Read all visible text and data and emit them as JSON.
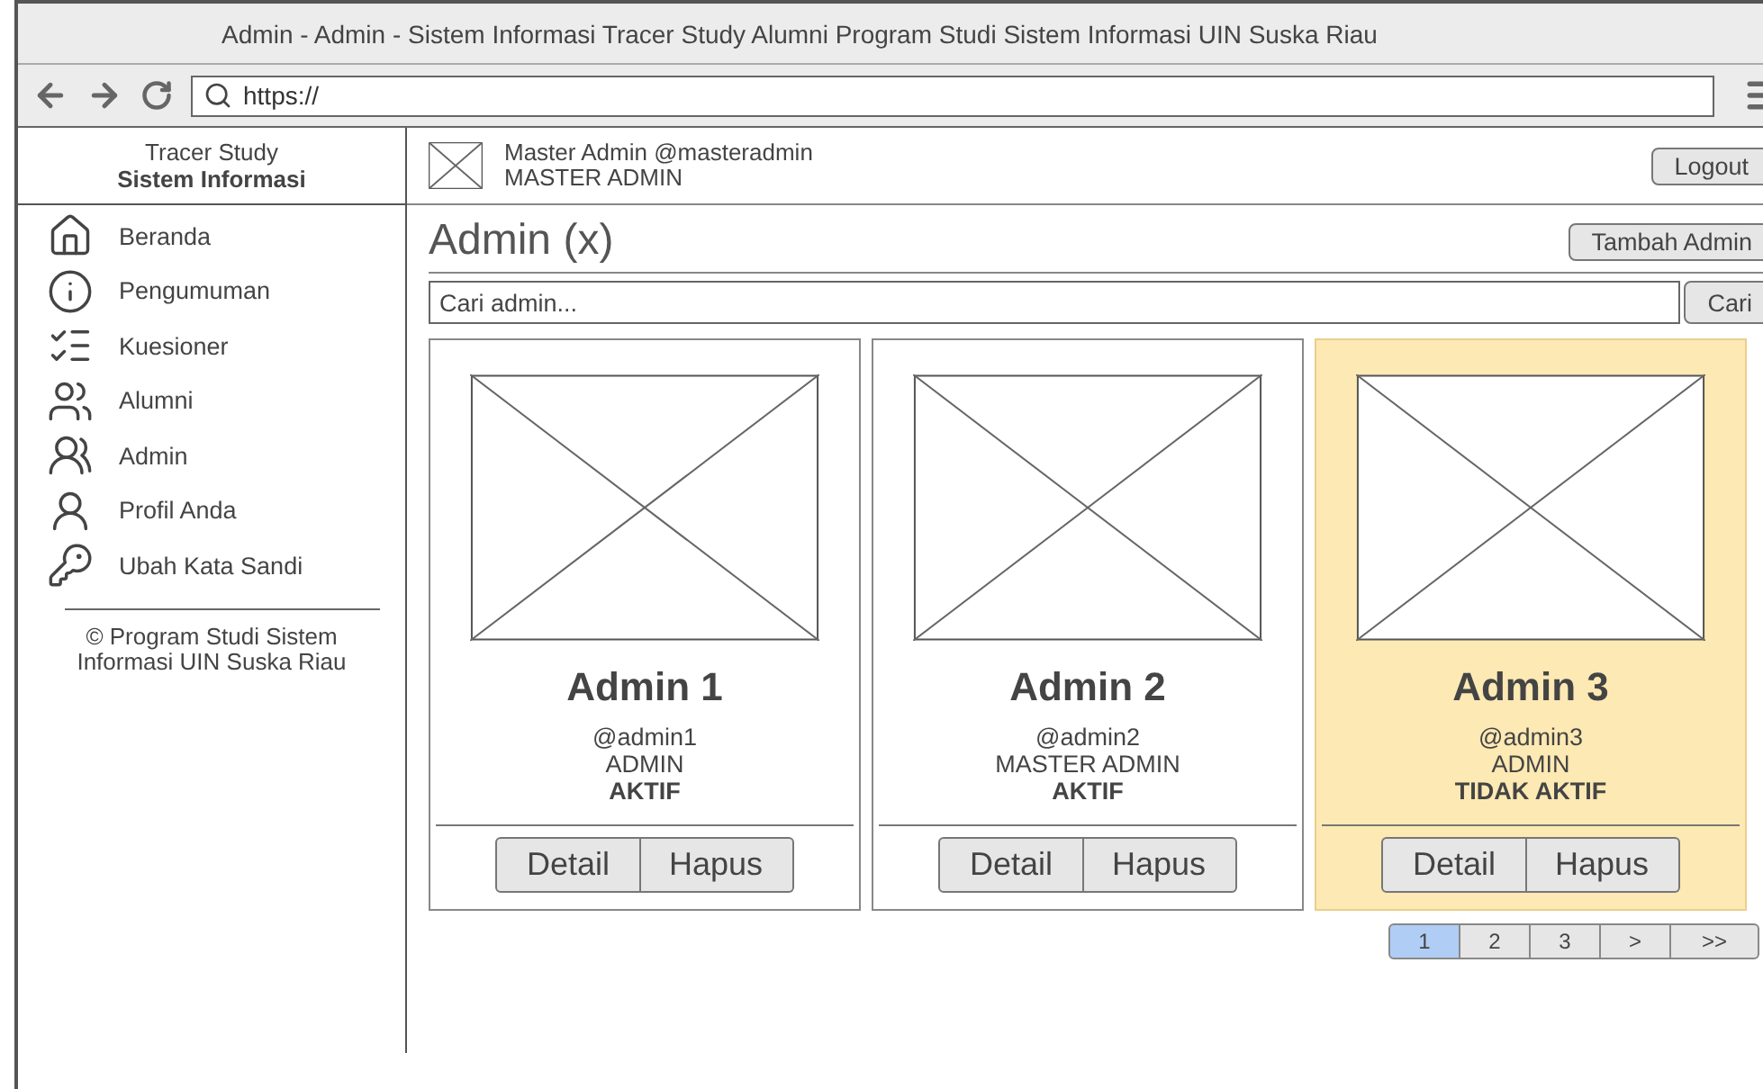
{
  "window": {
    "title": "Admin - Admin - Sistem Informasi Tracer Study Alumni Program Studi Sistem Informasi UIN Suska Riau"
  },
  "address_bar": {
    "value": "https://"
  },
  "sidebar": {
    "title": "Tracer Study",
    "subtitle": "Sistem Informasi",
    "items": [
      {
        "label": "Beranda"
      },
      {
        "label": "Pengumuman"
      },
      {
        "label": "Kuesioner"
      },
      {
        "label": "Alumni"
      },
      {
        "label": "Admin"
      },
      {
        "label": "Profil Anda"
      },
      {
        "label": "Ubah Kata Sandi"
      }
    ],
    "footer": "© Program Studi Sistem Informasi UIN Suska Riau"
  },
  "header": {
    "user": "Master Admin @masteradmin",
    "role": "MASTER ADMIN",
    "logout": "Logout"
  },
  "page": {
    "title": "Admin (x)",
    "add_button": "Tambah Admin",
    "search": {
      "placeholder": "Cari admin...",
      "button": "Cari"
    }
  },
  "cards": [
    {
      "name": "Admin 1",
      "username": "@admin1",
      "role": "ADMIN",
      "status": "AKTIF",
      "selected": false,
      "detail": "Detail",
      "delete": "Hapus"
    },
    {
      "name": "Admin 2",
      "username": "@admin2",
      "role": "MASTER ADMIN",
      "status": "AKTIF",
      "selected": false,
      "detail": "Detail",
      "delete": "Hapus"
    },
    {
      "name": "Admin 3",
      "username": "@admin3",
      "role": "ADMIN",
      "status": "TIDAK AKTIF",
      "selected": true,
      "detail": "Detail",
      "delete": "Hapus"
    }
  ],
  "pagination": [
    {
      "label": "1",
      "selected": true
    },
    {
      "label": "2",
      "selected": false
    },
    {
      "label": "3",
      "selected": false
    },
    {
      "label": ">",
      "selected": false
    },
    {
      "label": ">>",
      "selected": false
    }
  ]
}
